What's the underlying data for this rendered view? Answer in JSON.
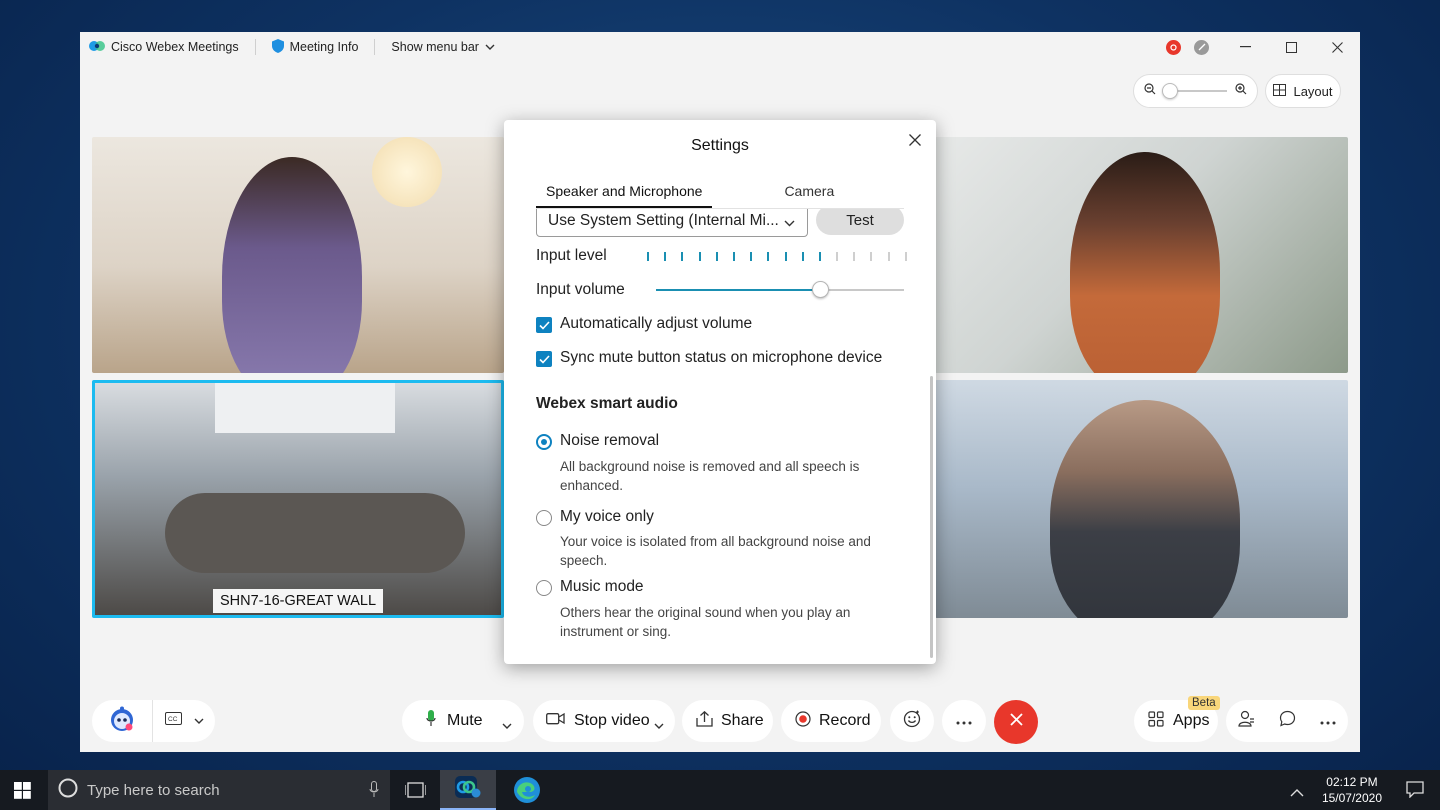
{
  "titlebar": {
    "app_name": "Cisco Webex Meetings",
    "meeting_info": "Meeting Info",
    "show_menu_bar": "Show menu bar"
  },
  "top_controls": {
    "layout_label": "Layout"
  },
  "video": {
    "active_tile_name": "SHN7-16-GREAT WALL"
  },
  "settings": {
    "title": "Settings",
    "tabs": [
      "Speaker and Microphone",
      "Camera"
    ],
    "microphone_select": "Use System Setting (Internal Mi...",
    "test_label": "Test",
    "input_level_label": "Input level",
    "input_level_active_bars": 11,
    "input_level_total_bars": 16,
    "input_volume_label": "Input volume",
    "input_volume_fraction": 0.66,
    "checkboxes": [
      {
        "label": "Automatically adjust volume",
        "checked": true
      },
      {
        "label": "Sync mute button status on microphone device",
        "checked": true
      }
    ],
    "smart_audio_title": "Webex smart audio",
    "options": [
      {
        "label": "Noise removal",
        "desc": "All background noise is removed and all speech is enhanced.",
        "selected": true
      },
      {
        "label": "My voice only",
        "desc": "Your voice is isolated from all background noise and speech.",
        "selected": false
      },
      {
        "label": "Music mode",
        "desc": "Others hear the original sound when you play an instrument or sing.",
        "selected": false
      }
    ]
  },
  "toolbar": {
    "mute": "Mute",
    "stop_video": "Stop video",
    "share": "Share",
    "record": "Record",
    "apps": "Apps",
    "beta": "Beta"
  },
  "taskbar": {
    "search_placeholder": "Type here to search",
    "time": "02:12 PM",
    "date": "15/07/2020"
  },
  "colors": {
    "accent": "#0e82c0",
    "end_call": "#e8372b",
    "active_tile_border": "#1cbbf0"
  }
}
